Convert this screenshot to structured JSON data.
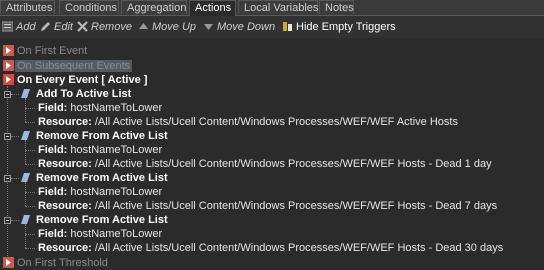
{
  "tabs": [
    {
      "label": "Attributes",
      "active": false
    },
    {
      "label": "Conditions",
      "active": false
    },
    {
      "label": "Aggregation",
      "active": false
    },
    {
      "label": "Actions",
      "active": true
    },
    {
      "label": "Local Variables",
      "active": false
    },
    {
      "label": "Notes",
      "active": false
    }
  ],
  "toolbar": {
    "add": "Add",
    "edit": "Edit",
    "remove": "Remove",
    "move_up": "Move Up",
    "move_down": "Move Down",
    "hide_empty": "Hide Empty Triggers"
  },
  "tree": {
    "on_first_event": "On First Event",
    "on_subsequent_events": "On Subsequent Events",
    "on_every_event": "On Every Event [ Active ]",
    "actions": [
      {
        "title": "Add To Active List",
        "field_label": "Field:",
        "field_value": "hostNameToLower",
        "resource_label": "Resource:",
        "resource_value": "/All Active Lists/Ucell Content/Windows Processes/WEF/WEF Active Hosts"
      },
      {
        "title": "Remove From Active List",
        "field_label": "Field:",
        "field_value": "hostNameToLower",
        "resource_label": "Resource:",
        "resource_value": "/All Active Lists/Ucell Content/Windows Processes/WEF/WEF Hosts - Dead 1 day"
      },
      {
        "title": "Remove From Active List",
        "field_label": "Field:",
        "field_value": "hostNameToLower",
        "resource_label": "Resource:",
        "resource_value": "/All Active Lists/Ucell Content/Windows Processes/WEF/WEF Hosts - Dead 7 days"
      },
      {
        "title": "Remove From Active List",
        "field_label": "Field:",
        "field_value": "hostNameToLower",
        "resource_label": "Resource:",
        "resource_value": "/All Active Lists/Ucell Content/Windows Processes/WEF/WEF Hosts - Dead 30 days"
      }
    ],
    "on_first_threshold": "On First Threshold"
  },
  "colors": {
    "background": "#2b2b2b",
    "trigger_icon_red": "#c0392b",
    "action_icon": "#8fb0d8"
  }
}
